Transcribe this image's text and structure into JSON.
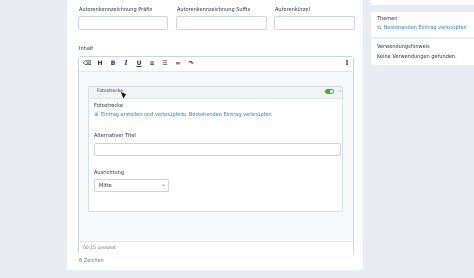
{
  "form": {
    "prefix_label": "Autorenkennzeichnung Präfix",
    "suffix_label": "Autorenkennzeichnung Suffix",
    "short_label": "Autorenkürzel",
    "content_label": "Inhalt",
    "char_count": "8 Zeichen"
  },
  "editor": {
    "toolbar_icons": [
      "eraser-icon",
      "heading-icon",
      "bold-icon",
      "italic-icon",
      "underline-icon",
      "bullet-list-icon",
      "numbered-list-icon",
      "link-icon",
      "redo-icon",
      "text-cursor-icon"
    ],
    "toolbar_glyphs": {
      "eraser": "⌫",
      "heading": "H",
      "bold": "B",
      "italic": "I",
      "underline": "U",
      "bullets": "≡",
      "numbers": "☰",
      "link": "∞",
      "redo": "↷",
      "cursor": "I"
    },
    "set_title": "Fotostrecke",
    "set_field_label": "Fotostrecke",
    "create_link": "Eintrag erstellen und verknüpfen",
    "link_existing": "Bestehenden Eintrag verknüpfen",
    "alt_title_label": "Alternativer Titel",
    "alignment_label": "Ausrichtung",
    "alignment_value": "Mitte",
    "more_glyph": "⋯",
    "chevron_glyph": "⌄",
    "reading_time": "00:15 Lesezeit",
    "fab_glyph": "✓"
  },
  "sidebar": {
    "topics_label": "Themen",
    "topics_link": "Bestehenden Eintrag verknüpfen",
    "usage_label": "Verwendungshinweis",
    "usage_value": "Keine Verwendungen gefunden."
  },
  "colors": {
    "accent": "#2b7cd3",
    "toggle_on": "#3fae4a",
    "background": "#e9edf1"
  }
}
